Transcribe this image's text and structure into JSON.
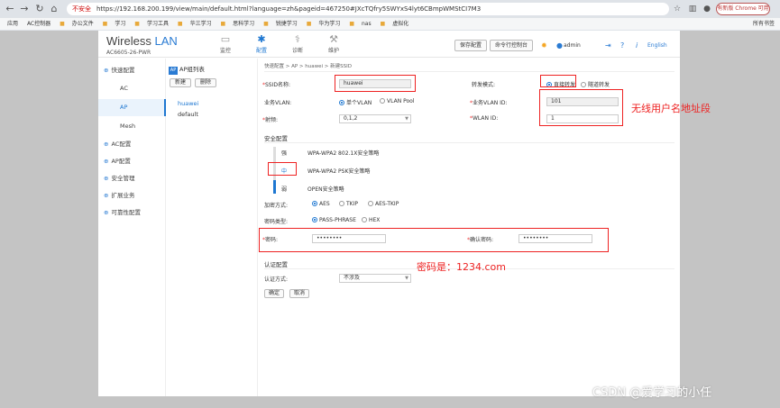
{
  "browser": {
    "security_label": "不安全",
    "url": "https://192.168.200.199/view/main/default.html?language=zh&pageid=467250#JXcTQfry5SWYxS4lyt6CBmpWMStCI7M3",
    "update_button": "有新版 Chrome 可用",
    "bookmarks": [
      "应用",
      "AC控制器",
      "办公文件",
      "学习",
      "学习工具",
      "华三学习",
      "思科学习",
      "锐捷学习",
      "华为学习",
      "nas",
      "虚拟化"
    ],
    "all_bookmarks": "所有书签"
  },
  "header": {
    "brand_prefix": "Wireless",
    "brand_suffix": "LAN",
    "model": "AC6605-26-PWR",
    "nav": [
      {
        "label": "监控",
        "icon": "monitor-icon"
      },
      {
        "label": "配置",
        "icon": "gear-icon"
      },
      {
        "label": "诊断",
        "icon": "diagnose-icon"
      },
      {
        "label": "维护",
        "icon": "maintenance-icon"
      }
    ],
    "save_button": "保存配置",
    "cli_button": "命令行控制台",
    "user": "admin",
    "language": "English"
  },
  "sidebar": {
    "items": [
      {
        "label": "快速配置",
        "level": 1
      },
      {
        "label": "AC",
        "level": 2
      },
      {
        "label": "AP",
        "level": 2,
        "active": true
      },
      {
        "label": "Mesh",
        "level": 2
      },
      {
        "label": "AC配置",
        "level": 1
      },
      {
        "label": "AP配置",
        "level": 1
      },
      {
        "label": "安全管理",
        "level": 1
      },
      {
        "label": "扩展业务",
        "level": 1
      },
      {
        "label": "可靠性配置",
        "level": 1
      }
    ]
  },
  "group_panel": {
    "title": "AP组列表",
    "new_button": "新建",
    "delete_button": "删除",
    "groups": [
      "huawei",
      "default"
    ]
  },
  "form": {
    "breadcrumb": "快速配置 > AP > huawei > 新建SSID",
    "ssid_label": "SSID名称:",
    "ssid_value": "huawei",
    "forward_label": "转发模式:",
    "forward_options": [
      "直接转发",
      "隧道转发"
    ],
    "forward_selected": "直接转发",
    "vlan_type_label": "业务VLAN:",
    "vlan_type_options": [
      "单个VLAN",
      "VLAN Pool"
    ],
    "vlan_type_selected": "单个VLAN",
    "vlan_id_label": "业务VLAN ID:",
    "vlan_id_value": "101",
    "band_label": "射频:",
    "band_value": "0,1,2",
    "wlan_id_label": "WLAN ID:",
    "wlan_id_value": "1",
    "security_title": "安全配置",
    "security_levels": [
      {
        "key": "强",
        "desc": "WPA-WPA2 802.1X安全策略"
      },
      {
        "key": "中",
        "desc": "WPA-WPA2 PSK安全策略"
      },
      {
        "key": "弱",
        "desc": "OPEN安全策略"
      }
    ],
    "security_level": 0.72,
    "encryption_label": "加密方式:",
    "encryption_options": [
      "AES",
      "TKIP",
      "AES-TKIP"
    ],
    "encryption_selected": "AES",
    "key_type_label": "密码类型:",
    "key_type_options": [
      "PASS-PHRASE",
      "HEX"
    ],
    "key_type_selected": "PASS-PHRASE",
    "password_label": "密码:",
    "password_value": "••••••••",
    "confirm_label": "确认密码:",
    "confirm_value": "••••••••",
    "auth_title": "认证配置",
    "auth_label": "认证方式:",
    "auth_value": "不涉及",
    "ok_button": "确定",
    "cancel_button": "取消"
  },
  "annotations": {
    "ssid_note": "无线用户名地址段",
    "password_note": "密码是：1234.com",
    "watermark": "CSDN @爱学习的小任",
    "color": "#e22222"
  }
}
